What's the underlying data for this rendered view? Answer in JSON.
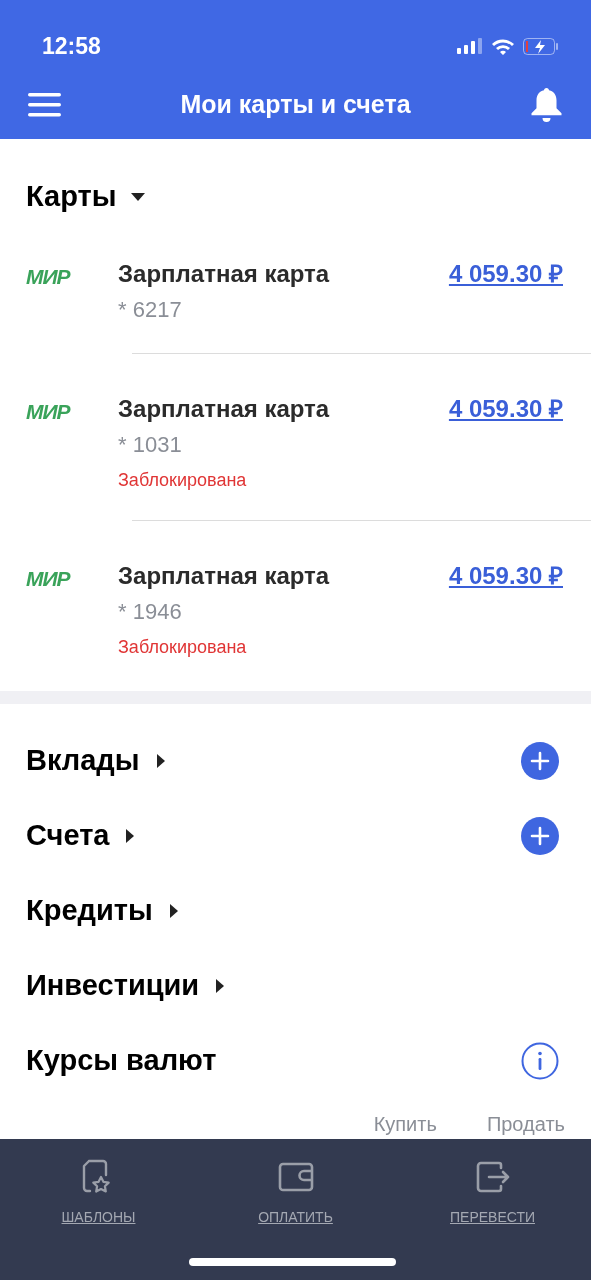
{
  "status_bar": {
    "time": "12:58"
  },
  "header": {
    "title": "Мои карты и счета"
  },
  "cards_section": {
    "title": "Карты",
    "expanded": true
  },
  "cards": [
    {
      "logo": "МИР",
      "name": "Зарплатная карта",
      "number": "* 6217",
      "amount": "4 059.30 ₽"
    },
    {
      "logo": "МИР",
      "name": "Зарплатная карта",
      "number": "* 1031",
      "amount": "4 059.30 ₽",
      "status": "Заблокирована"
    },
    {
      "logo": "МИР",
      "name": "Зарплатная карта",
      "number": "* 1946",
      "amount": "4 059.30 ₽",
      "status": "Заблокирована"
    }
  ],
  "sections": [
    {
      "kind": "add",
      "title": "Вклады",
      "expanded": false
    },
    {
      "kind": "add",
      "title": "Счета",
      "expanded": false
    },
    {
      "kind": "plain",
      "title": "Кредиты",
      "expanded": false
    },
    {
      "kind": "plain",
      "title": "Инвестиции",
      "expanded": false
    },
    {
      "kind": "info",
      "title": "Курсы валют"
    }
  ],
  "rates_columns": [
    "Купить",
    "Продать"
  ],
  "tab_bar": [
    {
      "kind": "templates",
      "label": "ШАБЛОНЫ"
    },
    {
      "kind": "pay",
      "label": "ОПЛАТИТЬ"
    },
    {
      "kind": "transfer",
      "label": "ПЕРЕВЕСТИ"
    }
  ]
}
